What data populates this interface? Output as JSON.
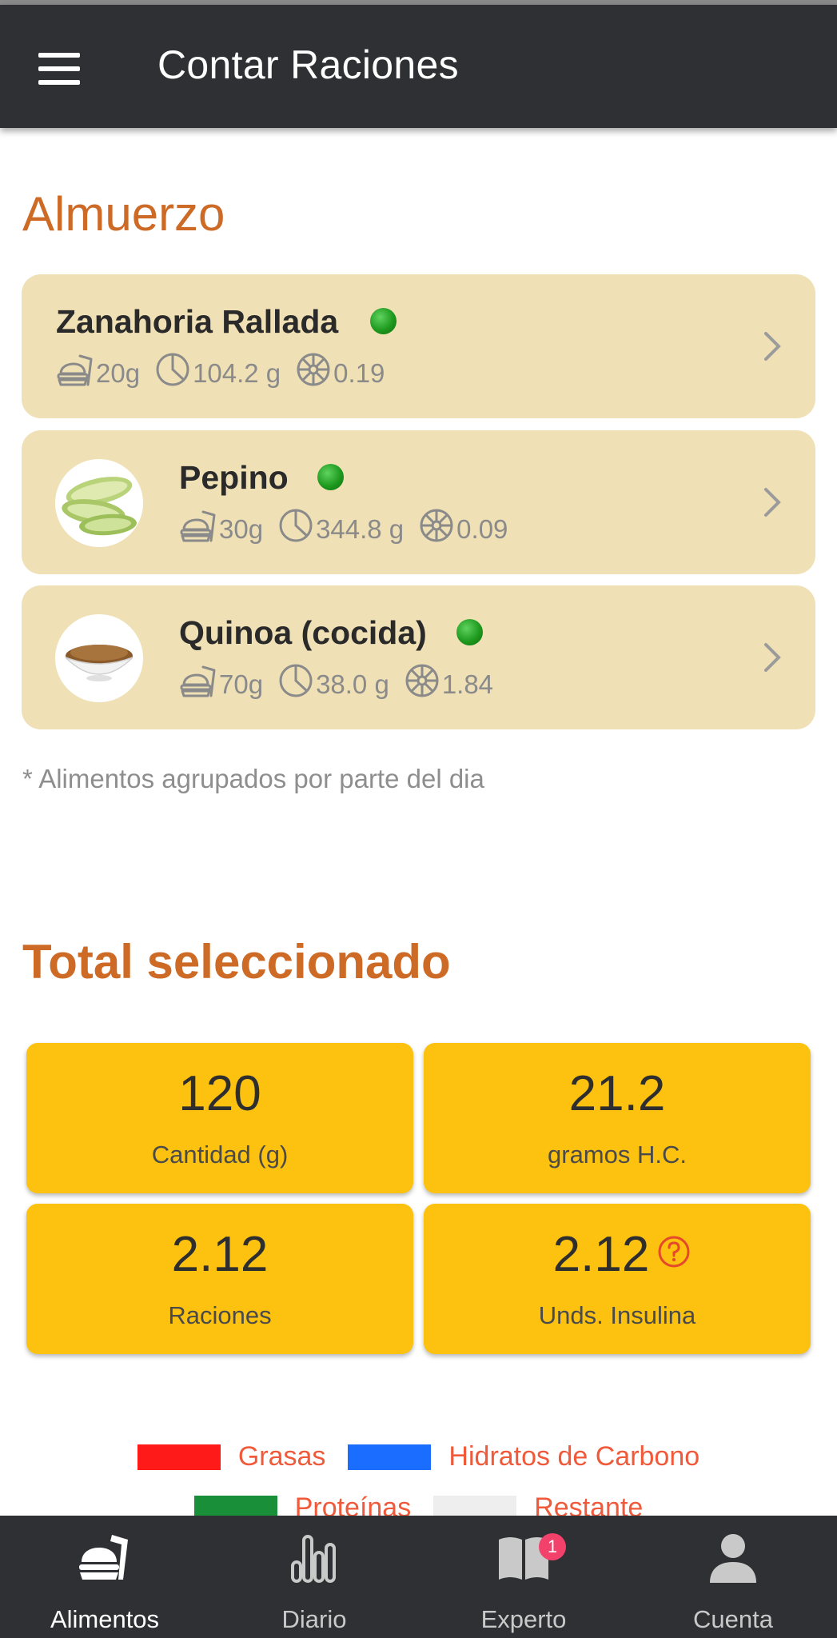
{
  "app_bar": {
    "title": "Contar Raciones"
  },
  "meal": {
    "title": "Almuerzo",
    "items": [
      {
        "name": "Zanahoria Rallada",
        "quantity": "20g",
        "carbs_per": "104.2 g",
        "raciones": "0.19",
        "status_color": "#1f9a1f",
        "has_image": false
      },
      {
        "name": "Pepino",
        "quantity": "30g",
        "carbs_per": "344.8 g",
        "raciones": "0.09",
        "status_color": "#1f9a1f",
        "has_image": true,
        "image": "cucumber-image"
      },
      {
        "name": "Quinoa (cocida)",
        "quantity": "70g",
        "carbs_per": "38.0 g",
        "raciones": "1.84",
        "status_color": "#1f9a1f",
        "has_image": true,
        "image": "quinoa-bowl-image"
      }
    ],
    "footnote": "* Alimentos agrupados por parte del dia"
  },
  "total": {
    "title": "Total seleccionado",
    "tiles": [
      {
        "value": "120",
        "label": "Cantidad (g)"
      },
      {
        "value": "21.2",
        "label": "gramos H.C."
      },
      {
        "value": "2.12",
        "label": "Raciones"
      },
      {
        "value": "2.12",
        "label": "Unds. Insulina"
      }
    ]
  },
  "legend": [
    {
      "label": "Grasas",
      "color": "#ff1a1a"
    },
    {
      "label": "Hidratos de Carbono",
      "color": "#1a6dff"
    },
    {
      "label": "Proteínas",
      "color": "#1a8f3a"
    },
    {
      "label": "Restante",
      "color": "#eeeeee"
    }
  ],
  "bottom_nav": [
    {
      "label": "Alimentos",
      "icon": "food-icon",
      "active": true
    },
    {
      "label": "Diario",
      "icon": "bar-chart-icon",
      "active": false
    },
    {
      "label": "Experto",
      "icon": "book-icon",
      "active": false,
      "badge": "1"
    },
    {
      "label": "Cuenta",
      "icon": "user-icon",
      "active": false
    }
  ],
  "colors": {
    "app_bar": "#2f3033",
    "accent": "#cd6a25",
    "card": "#efe0b5",
    "tile": "#fcc20f",
    "nav_active": "#ffffff",
    "nav_inactive": "#c9c9c9"
  }
}
